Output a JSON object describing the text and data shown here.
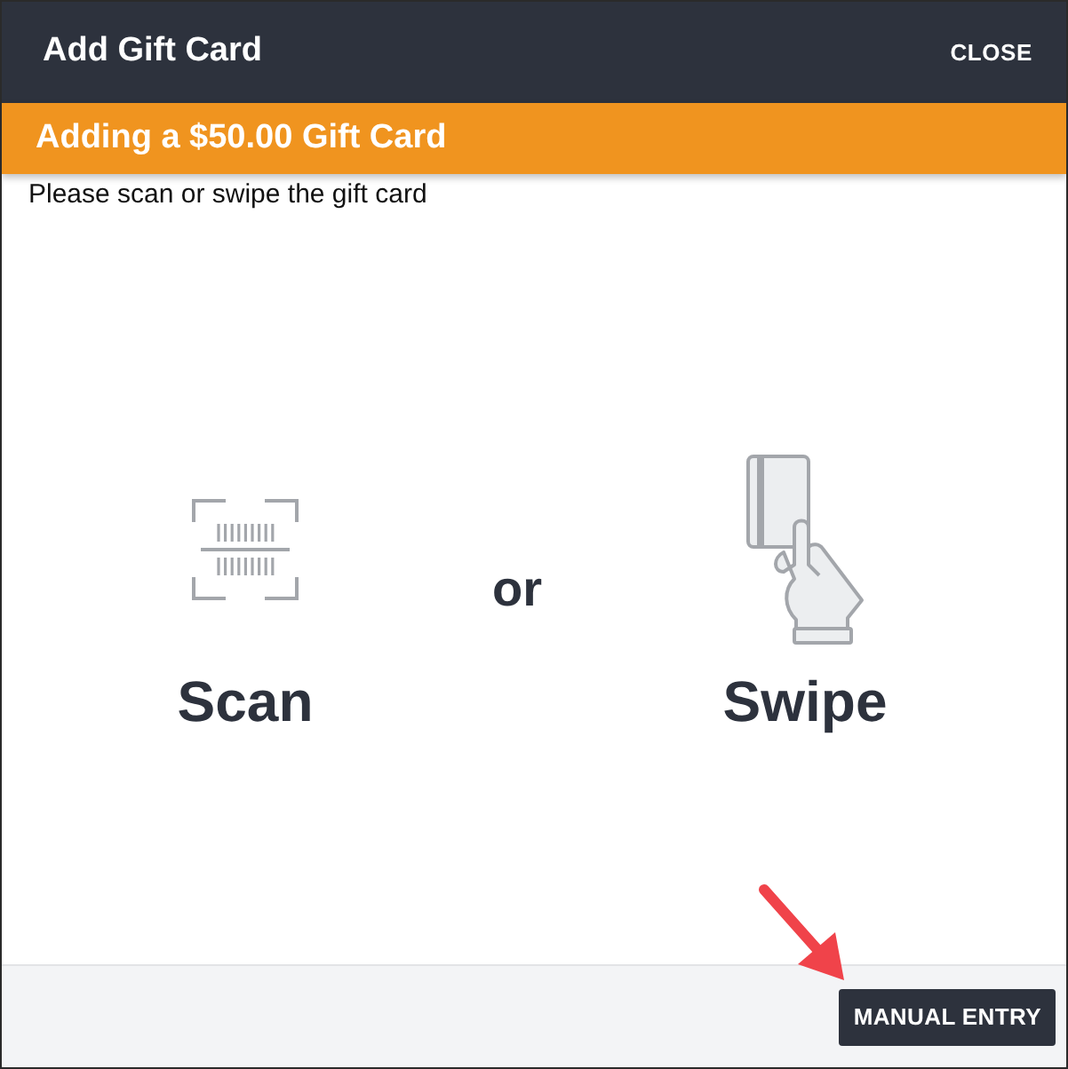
{
  "dialog": {
    "title": "Add Gift Card",
    "close_label": "CLOSE"
  },
  "banner": {
    "text": "Adding a $50.00 Gift Card"
  },
  "instruction": "Please scan or swipe the gift card",
  "options": [
    {
      "kind": "scan",
      "label": "Scan"
    },
    {
      "kind": "swipe",
      "label": "Swipe"
    }
  ],
  "separator": "or",
  "footer": {
    "button": "MANUAL ENTRY"
  }
}
